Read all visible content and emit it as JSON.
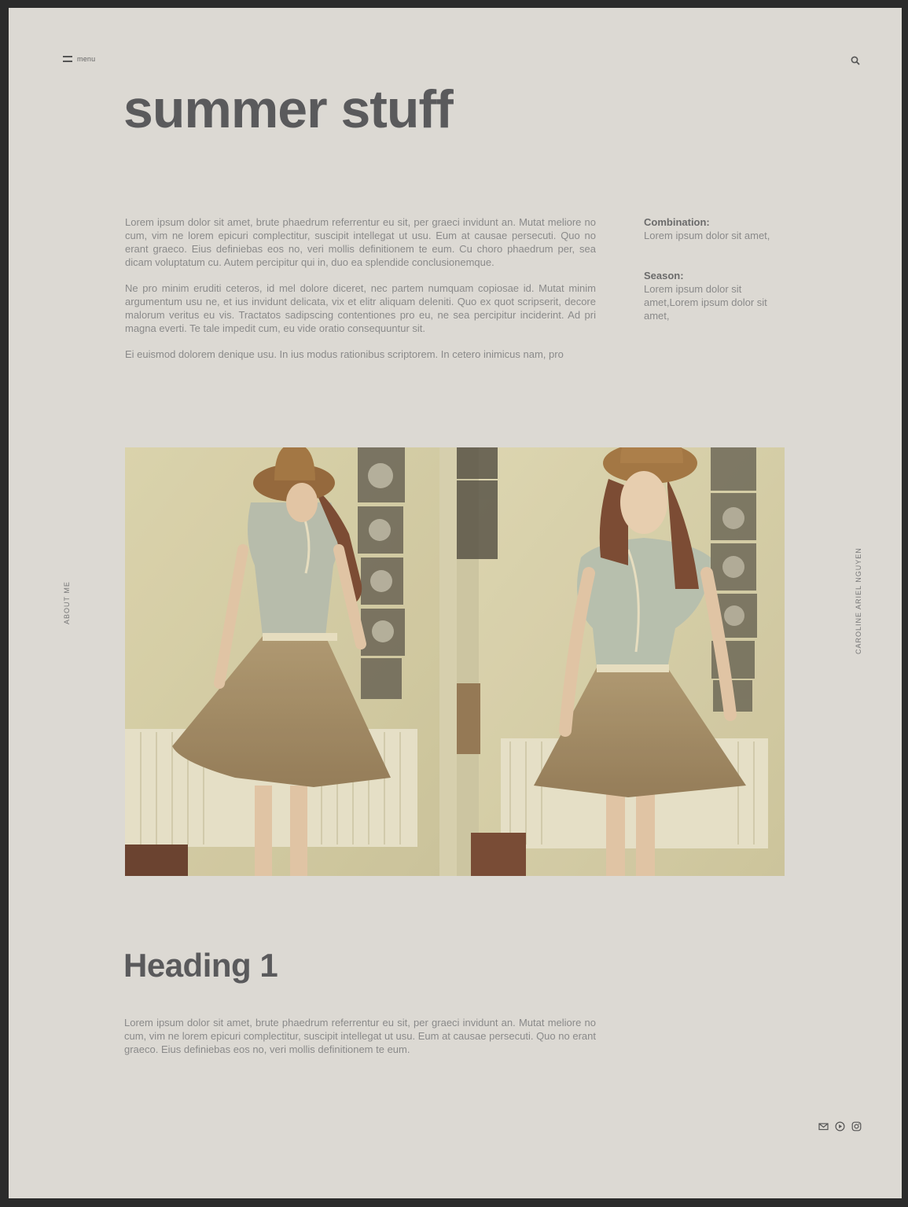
{
  "header": {
    "menu_label": "menu",
    "search_icon": "search-icon",
    "menu_icon": "hamburger-icon"
  },
  "title": "summer stuff",
  "intro": {
    "p1": "Lorem ipsum dolor sit amet, brute phaedrum referrentur eu sit, per graeci invidunt an. Mutat meliore no cum, vim ne lorem epicuri complectitur, suscipit intellegat ut usu. Eum at causae persecuti. Quo no erant graeco. Eius definiebas eos no, veri mollis definitionem te eum. Cu choro phaedrum per, sea dicam voluptatum cu. Autem percipitur qui in, duo ea splendide conclusionemque.",
    "p2": "Ne pro minim eruditi ceteros, id mel dolore diceret, nec partem numquam copiosae id. Mutat minim argumentum usu ne, et ius invidunt delicata, vix et elitr aliquam deleniti. Quo ex quot scripserit, decore malorum veritus eu vis. Tractatos sadipscing contentiones pro eu, ne sea percipitur inciderint. Ad pri magna everti. Te tale impedit cum, eu vide oratio consequuntur sit.",
    "p3": "Ei euismod dolorem denique usu. In ius modus rationibus scriptorem. In cetero inimicus nam, pro"
  },
  "sidebar": {
    "combination_label": "Combination:",
    "combination_value": "Lorem ipsum dolor sit amet,",
    "season_label": "Season:",
    "season_value": "Lorem ipsum dolor sit amet,Lorem ipsum dolor sit amet,"
  },
  "side_labels": {
    "left": "ABOUT ME",
    "right": "CAROLINE ARIEL NGUYEN"
  },
  "section": {
    "heading": "Heading 1",
    "body": "Lorem ipsum dolor sit amet, brute phaedrum referrentur eu sit, per graeci invidunt an. Mutat meliore no cum, vim ne lorem epicuri complectitur, suscipit intellegat ut usu. Eum at causae persecuti. Quo no erant graeco. Eius definiebas eos no, veri mollis definitionem te eum."
  },
  "social": [
    "mail-icon",
    "play-icon",
    "instagram-icon"
  ]
}
